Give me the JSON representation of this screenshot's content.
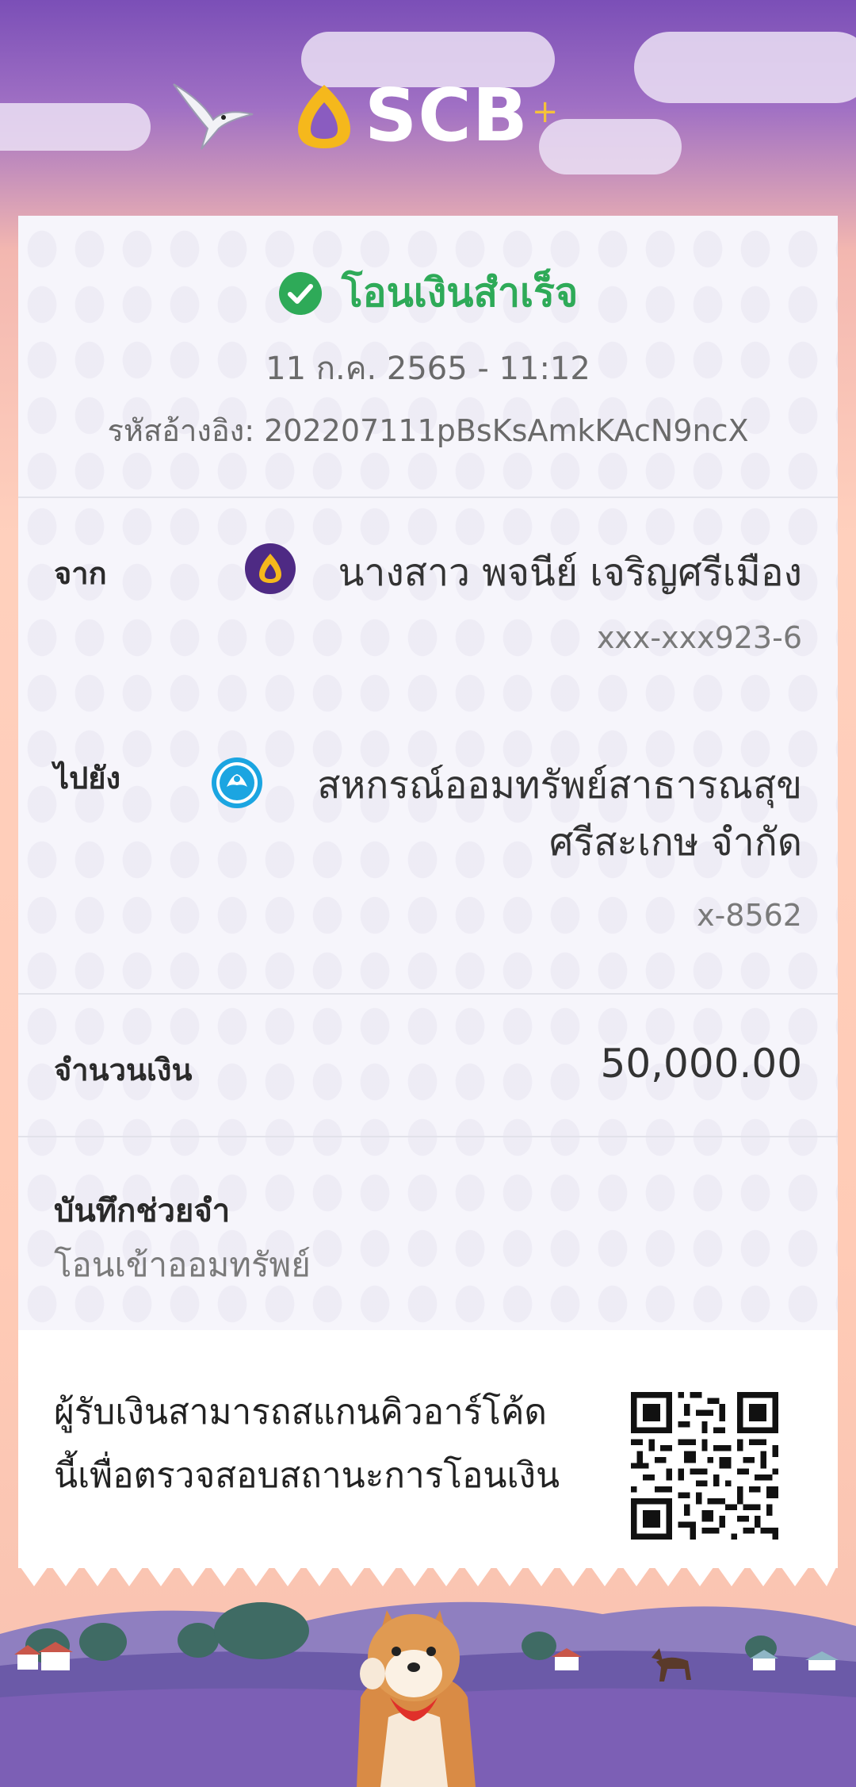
{
  "brand": {
    "name": "SCB",
    "plus": "+"
  },
  "receipt": {
    "status": "โอนเงินสำเร็จ",
    "datetime": "11 ก.ค. 2565 - 11:12",
    "reference": "รหัสอ้างอิง: 202207111pBsKsAmkKAcN9ncX",
    "from": {
      "label": "จาก",
      "name": "นางสาว พจนีย์ เจริญศรีเมือง",
      "account": "xxx-xxx923-6"
    },
    "to": {
      "label": "ไปยัง",
      "name_line1": "สหกรณ์ออมทรัพย์สาธารณสุข",
      "name_line2": "ศรีสะเกษ จำกัด",
      "account": "x-8562"
    },
    "amount": {
      "label": "จำนวนเงิน",
      "value": "50,000.00"
    },
    "memo": {
      "label": "บันทึกช่วยจำ",
      "value": "โอนเข้าออมทรัพย์"
    },
    "qr_note": {
      "line1": "ผู้รับเงินสามารถสแกนคิวอาร์โค้ด",
      "line2": "นี้เพื่อตรวจสอบสถานะการโอนเงิน"
    }
  },
  "icons": {
    "status": "check-circle-icon",
    "from_bank": "scb-bank-icon",
    "to_bank": "krungthai-bank-icon",
    "qr": "qr-code"
  },
  "colors": {
    "success": "#2eaa58",
    "brand_purple": "#4e2a84",
    "brand_gold": "#f5c23a",
    "ktb_blue": "#1ba5e1"
  }
}
